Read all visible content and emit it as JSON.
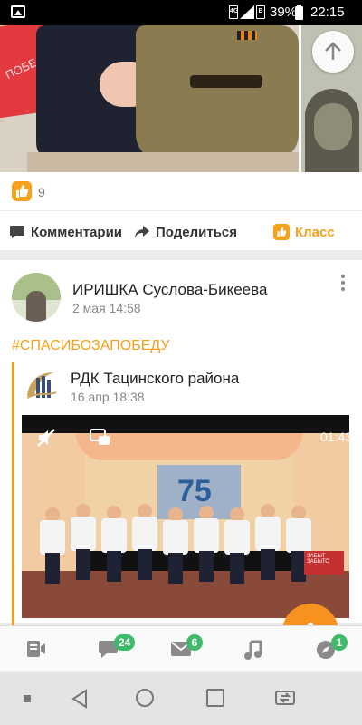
{
  "status_bar": {
    "battery_percent": "39%",
    "time": "22:15",
    "sim1_label": "4G",
    "sim2_label": "B"
  },
  "first_post": {
    "flag_text": "ПОБЕДЫ",
    "likes_count": "9",
    "actions": {
      "comments_label": "Комментарии",
      "share_label": "Поделиться",
      "like_label": "Класс"
    }
  },
  "second_post": {
    "author_name": "ИРИШКА Суслова-Бикеева",
    "date": "2 мая 14:58",
    "hashtag": "#СПАСИБОЗАПОБЕДУ",
    "repost": {
      "group_name": "РДК Тацинского района",
      "date": "16 апр 18:38",
      "video": {
        "duration": "01:43",
        "screen_number": "75",
        "sign_text": "ЗАБЫТ ЗАБЫТО"
      }
    }
  },
  "bottom_nav": {
    "items": [
      {
        "icon": "feed-icon",
        "badge": ""
      },
      {
        "icon": "discussions-icon",
        "badge": "24"
      },
      {
        "icon": "messages-icon",
        "badge": "6"
      },
      {
        "icon": "music-icon",
        "badge": ""
      },
      {
        "icon": "notifications-icon",
        "badge": "1"
      }
    ]
  },
  "colors": {
    "accent": "#f59f1a",
    "badge": "#3dba6a"
  }
}
